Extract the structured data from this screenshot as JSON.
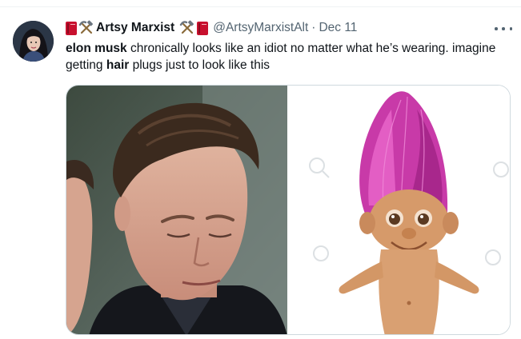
{
  "tweet": {
    "display_name": "Artsy Marxist",
    "handle": "@ArtsyMarxistAlt",
    "separator": "·",
    "date": "Dec 11",
    "text": {
      "bold1": "elon musk",
      "part1": " chronically looks like an idiot no matter what he’s wearing. imagine getting ",
      "bold2": "hair",
      "part2": " plugs just to look like this"
    }
  },
  "icons": {
    "avatar": "avatar",
    "book": "red-book-icon",
    "tools": "hammer-and-pick-icon",
    "more": "more-options-icon"
  },
  "colors": {
    "text": "#0f1419",
    "secondary": "#536471",
    "border": "#cfd9de",
    "book_red": "#c8102e",
    "troll_hair": "#c83aa8"
  }
}
